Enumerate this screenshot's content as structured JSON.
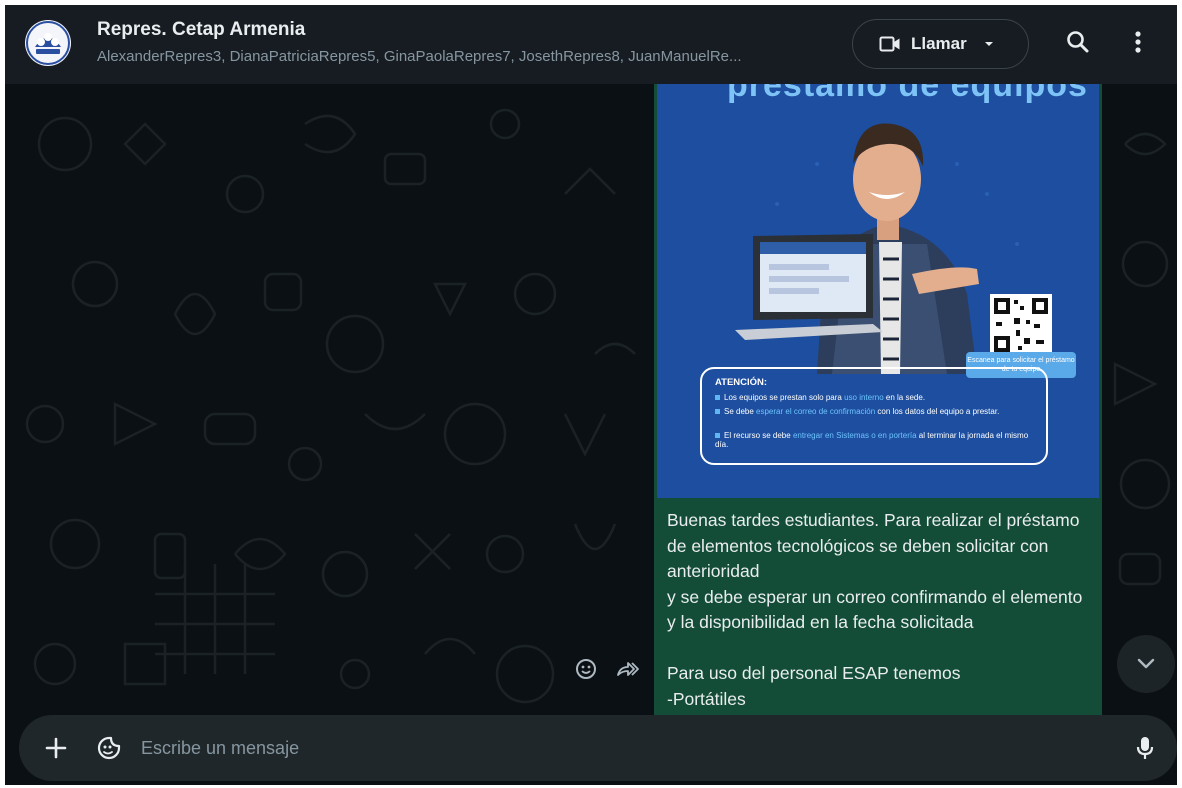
{
  "header": {
    "title": "Repres. Cetap Armenia",
    "members": "AlexanderRepres3, DianaPatriciaRepres5, GinaPaolaRepres7, JosethRepres8, JuanManuelRe...",
    "call_label": "Llamar",
    "avatar_icon": "group-logo-icon",
    "search_icon": "search-icon",
    "menu_icon": "more-vertical-icon"
  },
  "message": {
    "poster": {
      "title": "préstamo de equipos",
      "attention_heading": "ATENCIÓN:",
      "line1_a": "Los equipos se prestan solo para ",
      "line1_b": "uso interno",
      "line1_c": " en la sede.",
      "line2_a": "Se debe ",
      "line2_b": "esperar el correo de confirmación",
      "line2_c": " con los datos del equipo a prestar.",
      "line3_a": "El recurso se debe ",
      "line3_b": "entregar en Sistemas o en portería",
      "line3_c": " al terminar la jornada el mismo día.",
      "scan_label": "Escanea para solicitar el préstamo de tu equipo"
    },
    "text": "Buenas tardes estudiantes. Para realizar el préstamo de elementos tecnológicos se deben solicitar con anterioridad\ny se debe esperar un correo confirmando el elemento y la disponibilidad en la fecha solicitada\n\nPara uso del personal ESAP tenemos\n-Portátiles",
    "react_icon": "emoji-react-icon",
    "forward_icon": "forward-icon"
  },
  "composer": {
    "placeholder": "Escribe un mensaje",
    "attach_icon": "plus-icon",
    "sticker_icon": "sticker-icon",
    "mic_icon": "microphone-icon"
  },
  "colors": {
    "header_bg": "#161c21",
    "chat_bg": "#0b1014",
    "bubble_bg": "#144d37",
    "poster_bg": "#1d4e9f",
    "text": "#e9edef",
    "muted": "#8696a0"
  }
}
